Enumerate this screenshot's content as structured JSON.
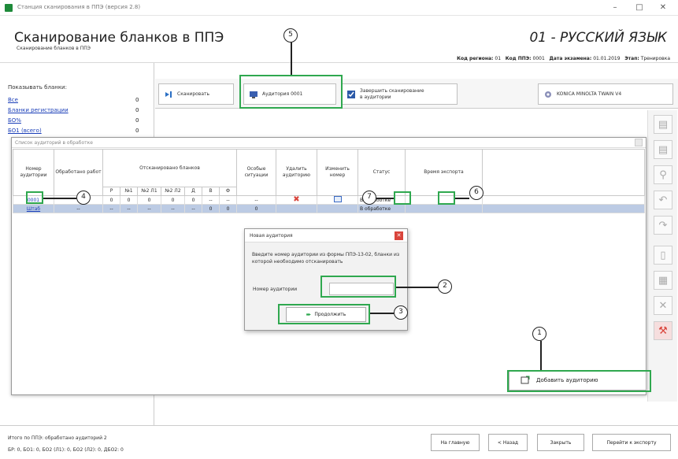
{
  "window": {
    "title": "Станция сканирования в ППЭ (версия 2.8)",
    "minimize": "–",
    "maximize": "□",
    "close": "✕"
  },
  "header": {
    "title": "Сканирование бланков в ППЭ",
    "subtitle": "Сканирование бланков в ППЭ",
    "subject": "01 - РУССКИЙ ЯЗЫК",
    "meta": {
      "region_label": "Код региона:",
      "region_value": "01",
      "ppe_label": "Код ППЭ:",
      "ppe_value": "0001",
      "date_label": "Дата экзамена:",
      "date_value": "01.01.2019",
      "stage_label": "Этап:",
      "stage_value": "Тренировка"
    }
  },
  "left_panel": {
    "show_label": "Показывать бланки:",
    "items": [
      {
        "label": "Все",
        "count": "0"
      },
      {
        "label": "Бланки регистрации",
        "count": "0"
      },
      {
        "label": "БО%",
        "count": "0"
      },
      {
        "label": "БО1 (всего)",
        "count": "0"
      }
    ]
  },
  "toolbar": {
    "scan_label": "Сканировать",
    "auditorium_label": "Аудитория 0001",
    "finish_label_line1": "Завершить сканирование",
    "finish_label_line2": "в аудитории",
    "scanner_label": "KONICA MINOLTA TWAIN V4"
  },
  "dialog": {
    "title": "Список аудиторий в обработке",
    "headers": {
      "aud_no": "Номер аудитории",
      "processed": "Обработано работ",
      "scanned": "Отсканировано бланков",
      "special": "Особые ситуации",
      "delete": "Удалить аудиторию",
      "change": "Изменить номер",
      "status": "Статус",
      "export_time": "Время экспорта"
    },
    "sub_headers": [
      "Р",
      "№1",
      "№2 Л1",
      "№2 Л2",
      "Д",
      "В",
      "Ф"
    ],
    "rows": [
      {
        "aud": "0001",
        "processed": "0",
        "vals": [
          "0",
          "0",
          "0",
          "0",
          "0",
          "--",
          "--"
        ],
        "special": "--",
        "status": "В обработке"
      },
      {
        "aud": "Штаб",
        "processed": "--",
        "vals": [
          "--",
          "--",
          "--",
          "--",
          "--",
          "0",
          "0"
        ],
        "special": "0",
        "status": "В обработке"
      }
    ],
    "add_button": "Добавить аудиторию"
  },
  "prompt": {
    "title": "Новая аудитория",
    "text": "Введите номер аудитории из формы ППЭ-13-02, бланки из которой необходимо отсканировать",
    "input_label": "Номер аудитории",
    "input_value": "",
    "continue_label": "Продолжить"
  },
  "callouts": [
    "1",
    "2",
    "3",
    "4",
    "5",
    "6",
    "7"
  ],
  "footer": {
    "line1": "Итого по ППЭ: обработано аудиторий 2",
    "line2": "БР: 0, БО1: 0, БО2 (Л1): 0, БО2 (Л2): 0, ДБО2: 0",
    "btn_main": "На главную",
    "btn_back": "< Назад",
    "btn_close": "Закрыть",
    "btn_export": "Перейти к экспорту"
  },
  "colors": {
    "highlight": "#2fa84f",
    "link": "#1a3eb8",
    "selected_row": "#bccbe4",
    "delete_red": "#d9443b"
  }
}
